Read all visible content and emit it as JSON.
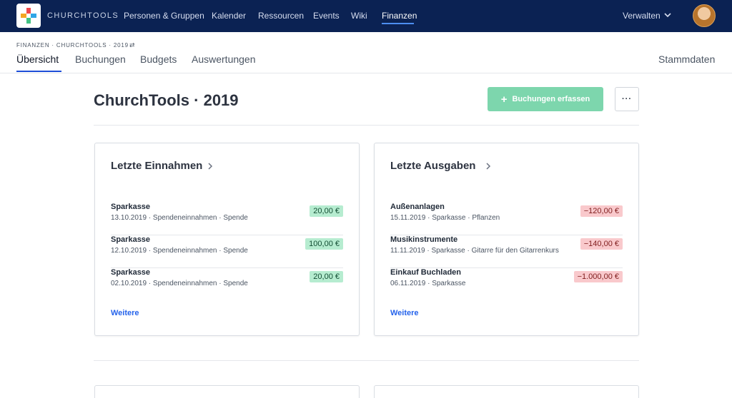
{
  "header": {
    "brand": "CHURCHTOOLS",
    "nav": [
      "Personen & Gruppen",
      "Kalender",
      "Ressourcen",
      "Events",
      "Wiki",
      "Finanzen"
    ],
    "active_nav": "Finanzen",
    "manage": "Verwalten"
  },
  "subheader": {
    "breadcrumb": "FINANZEN · CHURCHTOOLS · 2019",
    "swap_icon": "⇄",
    "tabs": [
      "Übersicht",
      "Buchungen",
      "Budgets",
      "Auswertungen"
    ],
    "active_tab": "Übersicht",
    "right_link": "Stammdaten"
  },
  "page": {
    "title": "ChurchTools · 2019",
    "primary_button": "Buchungen erfassen",
    "primary_button_icon": "+",
    "more_button": "···"
  },
  "income": {
    "title": "Letzte Einnahmen",
    "items": [
      {
        "name": "Sparkasse",
        "meta": "13.10.2019 · Spendeneinnahmen · Spende",
        "amount": "20,00 €"
      },
      {
        "name": "Sparkasse",
        "meta": "12.10.2019 · Spendeneinnahmen · Spende",
        "amount": "100,00 €"
      },
      {
        "name": "Sparkasse",
        "meta": "02.10.2019 · Spendeneinnahmen · Spende",
        "amount": "20,00 €"
      }
    ],
    "more": "Weitere"
  },
  "expenses": {
    "title": "Letzte Ausgaben",
    "items": [
      {
        "name": "Außenanlagen",
        "meta": "15.11.2019 · Sparkasse · Pflanzen",
        "amount": "−120,00 €"
      },
      {
        "name": "Musikinstrumente",
        "meta": "11.11.2019 · Sparkasse · Gitarre für den Gitarrenkurs",
        "amount": "−140,00 €"
      },
      {
        "name": "Einkauf Buchladen",
        "meta": "06.11.2019 · Sparkasse",
        "amount": "−1.000,00 €"
      }
    ],
    "more": "Weitere"
  },
  "colors": {
    "nav_bg": "#0b2253",
    "accent": "#4d8ef0",
    "primary_button": "#7dd6ad",
    "positive_badge": "#b6ecd0",
    "negative_badge": "#f9c9cc",
    "link": "#2563eb"
  },
  "icons": {
    "logo": "churchtools-logo-icon",
    "manage_chevron": "chevron-down-icon",
    "card_chevron": "chevron-right-icon",
    "avatar": "user-avatar"
  }
}
